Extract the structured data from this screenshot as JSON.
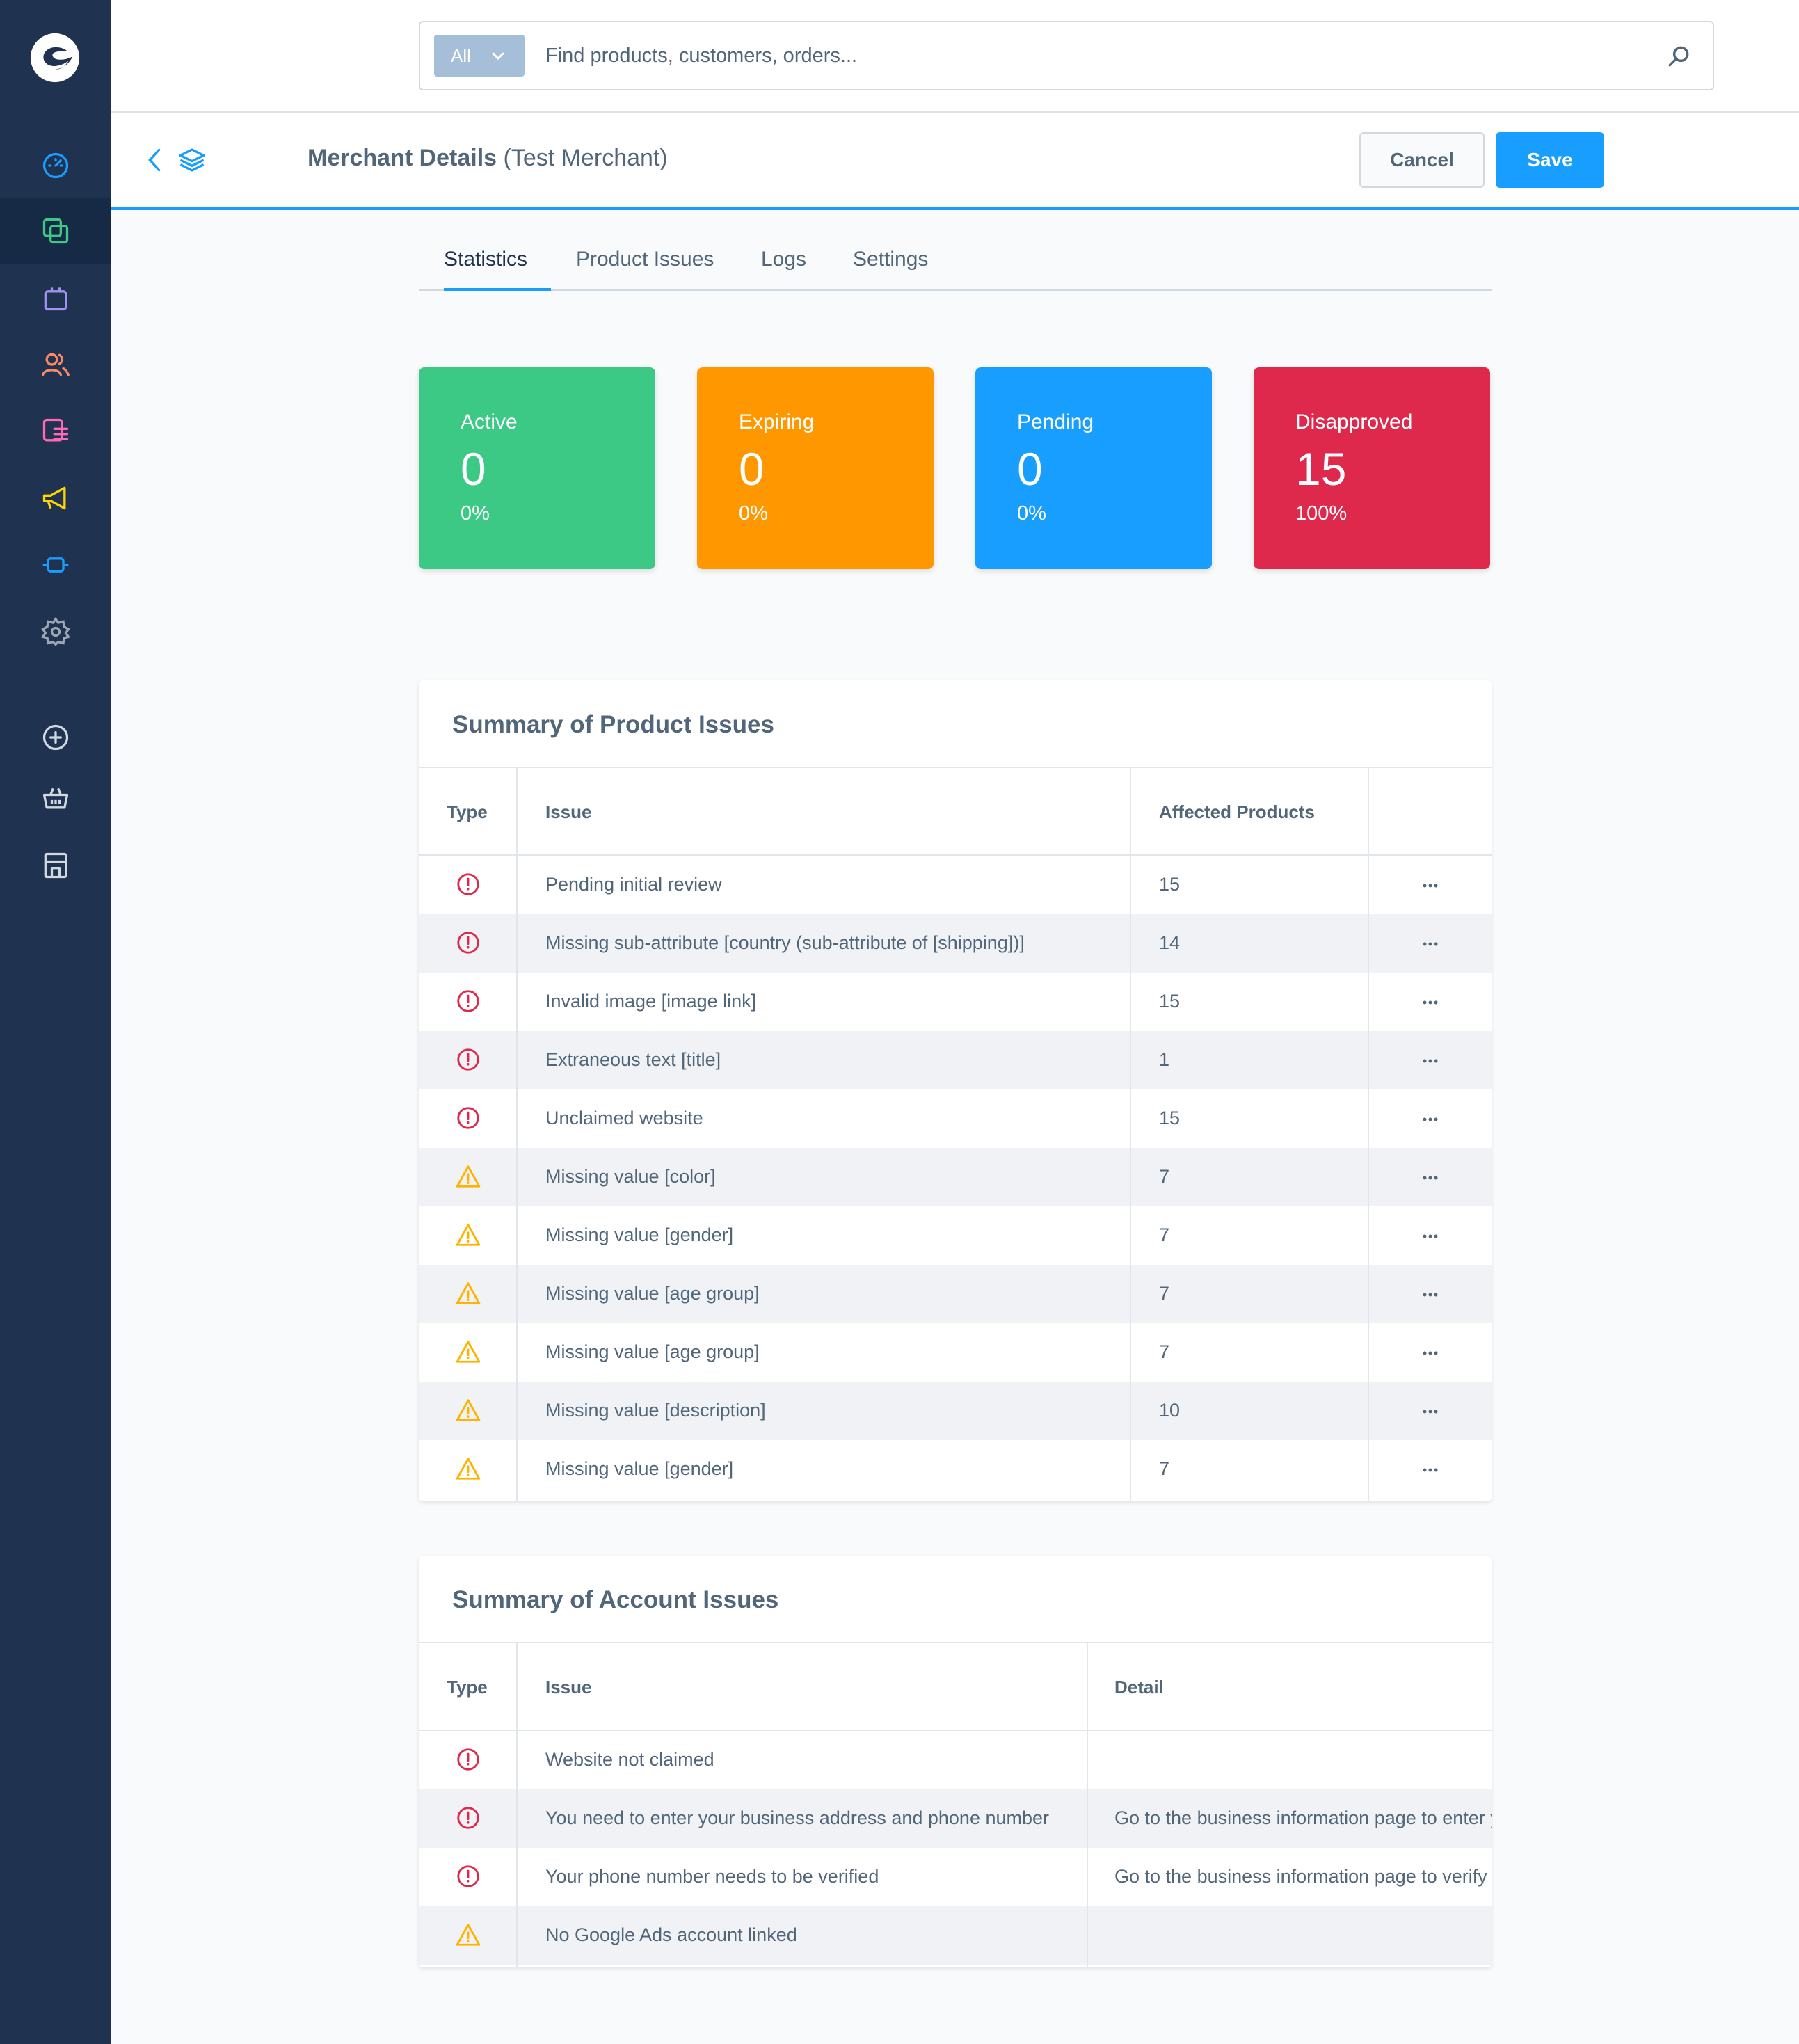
{
  "search": {
    "type_label": "All",
    "placeholder": "Find products, customers, orders..."
  },
  "header": {
    "title": "Merchant Details",
    "subtitle": "(Test Merchant)",
    "cancel_label": "Cancel",
    "save_label": "Save"
  },
  "tabs": [
    {
      "label": "Statistics",
      "active": true
    },
    {
      "label": "Product Issues",
      "active": false
    },
    {
      "label": "Logs",
      "active": false
    },
    {
      "label": "Settings",
      "active": false
    }
  ],
  "stats": [
    {
      "label": "Active",
      "value": "0",
      "percent": "0%",
      "color": "#3cc986"
    },
    {
      "label": "Expiring",
      "value": "0",
      "percent": "0%",
      "color": "#ff9800"
    },
    {
      "label": "Pending",
      "value": "0",
      "percent": "0%",
      "color": "#189eff"
    },
    {
      "label": "Disapproved",
      "value": "15",
      "percent": "100%",
      "color": "#de294c"
    }
  ],
  "product_issues": {
    "title": "Summary of Product Issues",
    "columns": [
      "Type",
      "Issue",
      "Affected Products"
    ],
    "rows": [
      {
        "type": "error",
        "issue": "Pending initial review",
        "affected": "15"
      },
      {
        "type": "error",
        "issue": "Missing sub-attribute [country (sub-attribute of [shipping])]",
        "affected": "14"
      },
      {
        "type": "error",
        "issue": "Invalid image [image link]",
        "affected": "15"
      },
      {
        "type": "error",
        "issue": "Extraneous text [title]",
        "affected": "1"
      },
      {
        "type": "error",
        "issue": "Unclaimed website",
        "affected": "15"
      },
      {
        "type": "warning",
        "issue": "Missing value [color]",
        "affected": "7"
      },
      {
        "type": "warning",
        "issue": "Missing value [gender]",
        "affected": "7"
      },
      {
        "type": "warning",
        "issue": "Missing value [age group]",
        "affected": "7"
      },
      {
        "type": "warning",
        "issue": "Missing value [age group]",
        "affected": "7"
      },
      {
        "type": "warning",
        "issue": "Missing value [description]",
        "affected": "10"
      },
      {
        "type": "warning",
        "issue": "Missing value [gender]",
        "affected": "7"
      }
    ]
  },
  "account_issues": {
    "title": "Summary of Account Issues",
    "columns": [
      "Type",
      "Issue",
      "Detail"
    ],
    "rows": [
      {
        "type": "error",
        "issue": "Website not claimed",
        "detail": ""
      },
      {
        "type": "error",
        "issue": "You need to enter your business address and phone number",
        "detail": "Go to the business information page to enter your"
      },
      {
        "type": "error",
        "issue": "Your phone number needs to be verified",
        "detail": "Go to the business information page to verify your"
      },
      {
        "type": "warning",
        "issue": "No Google Ads account linked",
        "detail": ""
      }
    ]
  },
  "colors": {
    "sidebar": "#1f3250",
    "accent": "#189eff",
    "error_icon": "#de294c",
    "warning_icon": "#ffb300"
  },
  "icons": {
    "sidebar": [
      "dashboard-icon",
      "catalog-icon",
      "orders-icon",
      "customers-icon",
      "content-icon",
      "marketing-icon",
      "extensions-icon",
      "settings-icon",
      "add-icon",
      "basket-icon",
      "storefront-icon"
    ],
    "error": "error-circle-icon",
    "warning": "warning-triangle-icon"
  }
}
